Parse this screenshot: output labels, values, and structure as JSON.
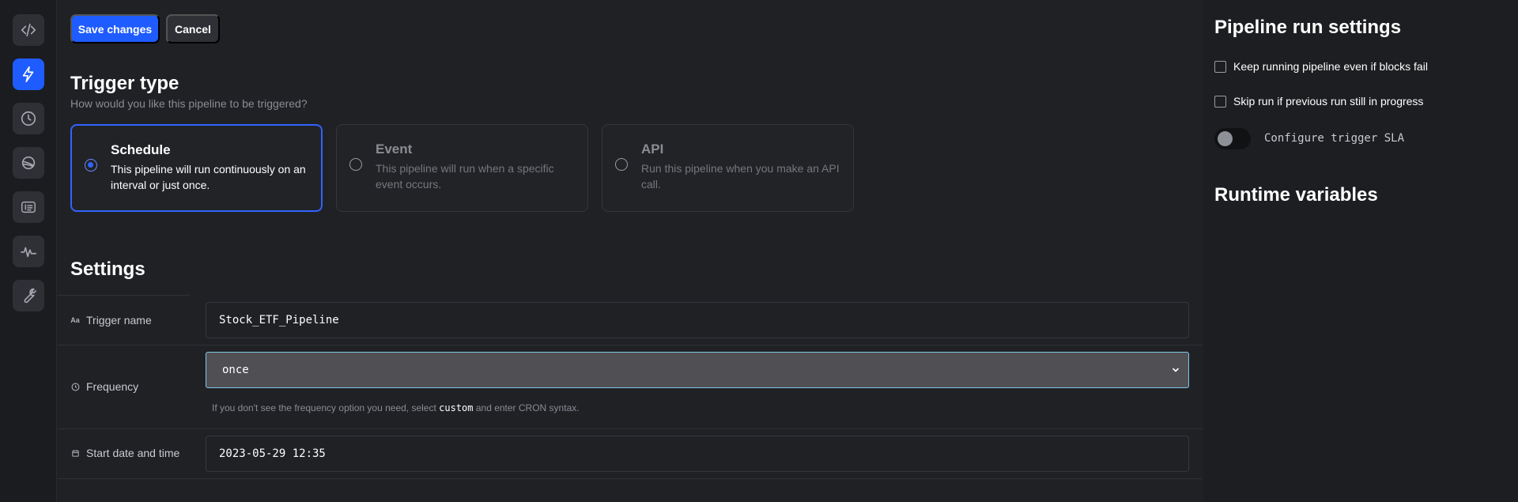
{
  "rail": {
    "items": [
      {
        "name": "code-icon",
        "active": false
      },
      {
        "name": "lightning-icon",
        "active": true
      },
      {
        "name": "clock-icon",
        "active": false
      },
      {
        "name": "planet-icon",
        "active": false
      },
      {
        "name": "logs-icon",
        "active": false
      },
      {
        "name": "pulse-icon",
        "active": false
      },
      {
        "name": "wrench-icon",
        "active": false
      }
    ]
  },
  "toolbar": {
    "save_label": "Save changes",
    "cancel_label": "Cancel"
  },
  "trigger_type": {
    "title": "Trigger type",
    "subtitle": "How would you like this pipeline to be triggered?",
    "options": [
      {
        "title": "Schedule",
        "description": "This pipeline will run continuously on an interval or just once.",
        "selected": true
      },
      {
        "title": "Event",
        "description": "This pipeline will run when a specific event occurs.",
        "selected": false
      },
      {
        "title": "API",
        "description": "Run this pipeline when you make an API call.",
        "selected": false
      }
    ]
  },
  "settings": {
    "title": "Settings",
    "trigger_name": {
      "icon_text": "Aa",
      "label": "Trigger name",
      "value": "Stock_ETF_Pipeline"
    },
    "frequency": {
      "label": "Frequency",
      "value": "once",
      "hint_before": "If you don't see the frequency option you need, select ",
      "hint_code": "custom",
      "hint_after": " and enter CRON syntax."
    },
    "start_date": {
      "label": "Start date and time",
      "value": "2023-05-29 12:35"
    }
  },
  "run_settings": {
    "title": "Pipeline run settings",
    "checkbox_keep_running": "Keep running pipeline even if blocks fail",
    "checkbox_skip_run": "Skip run if previous run still in progress",
    "sla_label": "Configure trigger SLA",
    "sla_enabled": false
  },
  "runtime_variables": {
    "title": "Runtime variables"
  },
  "colors": {
    "accent": "#1f5cff",
    "background": "#1f2023",
    "focus_border": "#7fc9e8"
  }
}
